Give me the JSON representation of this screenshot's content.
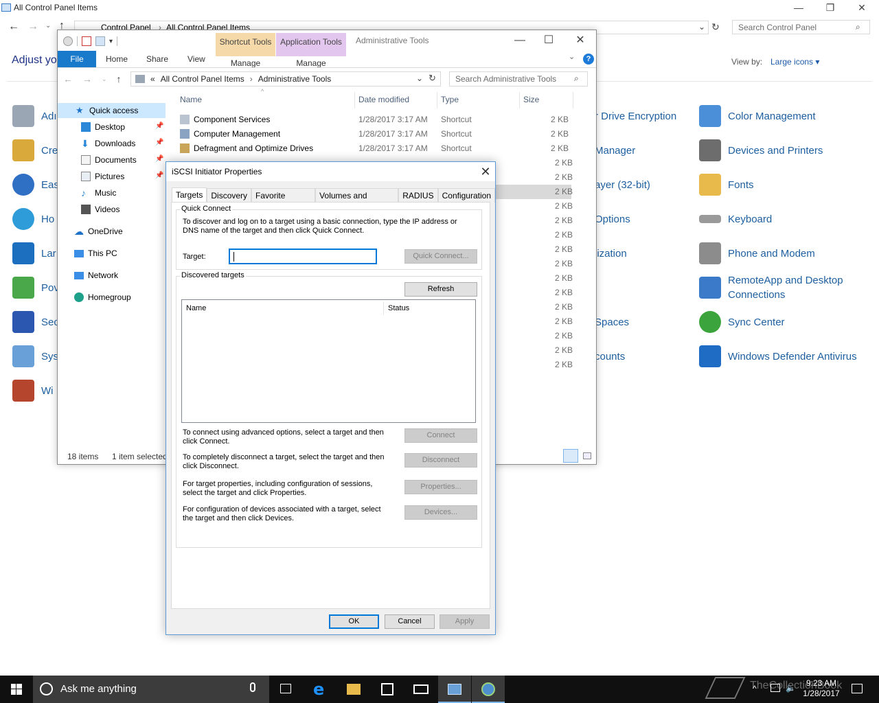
{
  "control_panel": {
    "title": "All Control Panel Items",
    "breadcrumb": [
      "Control Panel",
      "All Control Panel Items"
    ],
    "search_placeholder": "Search Control Panel",
    "heading": "Adjust yo",
    "view_by_label": "View by:",
    "view_by_value": "Large icons ▾",
    "left_column_partial": [
      "Adı",
      "Cre",
      "Eas",
      "Ho",
      "Lar",
      "Pov",
      "Sec",
      "Sys",
      "Wi"
    ],
    "middle_column_partial": [
      "r Drive Encryption",
      "Manager",
      "ayer (32-bit)",
      "Options",
      "lization",
      "Spaces",
      "counts"
    ],
    "right_column": [
      {
        "label": "Color Management",
        "icon": "color-management-icon",
        "color": "#4a8fd8"
      },
      {
        "label": "Devices and Printers",
        "icon": "printer-icon",
        "color": "#6d6d6d"
      },
      {
        "label": "Fonts",
        "icon": "fonts-icon",
        "color": "#e8b94b"
      },
      {
        "label": "Keyboard",
        "icon": "keyboard-icon",
        "color": "#9a9a9a"
      },
      {
        "label": "Phone and Modem",
        "icon": "phone-icon",
        "color": "#8c8c8c"
      },
      {
        "label": "RemoteApp and Desktop Connections",
        "icon": "remote-desktop-icon",
        "color": "#3b79c9"
      },
      {
        "label": "Sync Center",
        "icon": "sync-icon",
        "color": "#3ca43c"
      },
      {
        "label": "Windows Defender Antivirus",
        "icon": "shield-icon",
        "color": "#1f6cc5"
      }
    ]
  },
  "explorer": {
    "title": "Administrative Tools",
    "context_tabs": [
      {
        "group": "Shortcut Tools",
        "tab": "Manage"
      },
      {
        "group": "Application Tools",
        "tab": "Manage"
      }
    ],
    "tabs": [
      "File",
      "Home",
      "Share",
      "View"
    ],
    "address": [
      "«",
      "All Control Panel Items",
      "›",
      "Administrative Tools"
    ],
    "search_placeholder": "Search Administrative Tools",
    "columns": [
      "Name",
      "Date modified",
      "Type",
      "Size"
    ],
    "nav": [
      {
        "label": "Quick access",
        "pinned": false
      },
      {
        "label": "Desktop",
        "pinned": true
      },
      {
        "label": "Downloads",
        "pinned": true
      },
      {
        "label": "Documents",
        "pinned": true
      },
      {
        "label": "Pictures",
        "pinned": true
      },
      {
        "label": "Music",
        "pinned": false
      },
      {
        "label": "Videos",
        "pinned": false
      },
      {
        "label": "OneDrive",
        "pinned": false
      },
      {
        "label": "This PC",
        "pinned": false
      },
      {
        "label": "Network",
        "pinned": false
      },
      {
        "label": "Homegroup",
        "pinned": false
      }
    ],
    "files": [
      {
        "name": "Component Services",
        "date": "1/28/2017 3:17 AM",
        "type": "Shortcut",
        "size": "2 KB"
      },
      {
        "name": "Computer Management",
        "date": "1/28/2017 3:17 AM",
        "type": "Shortcut",
        "size": "2 KB"
      },
      {
        "name": "Defragment and Optimize Drives",
        "date": "1/28/2017 3:17 AM",
        "type": "Shortcut",
        "size": "2 KB"
      }
    ],
    "more_sizes": [
      "2 KB",
      "2 KB",
      "2 KB",
      "2 KB",
      "2 KB",
      "2 KB",
      "2 KB",
      "2 KB",
      "2 KB",
      "2 KB",
      "2 KB",
      "2 KB",
      "2 KB",
      "2 KB",
      "2 KB"
    ],
    "status_count": "18 items",
    "status_selected": "1 item selected"
  },
  "dialog": {
    "title": "iSCSI Initiator Properties",
    "tabs": [
      "Targets",
      "Discovery",
      "Favorite Targets",
      "Volumes and Devices",
      "RADIUS",
      "Configuration"
    ],
    "quick_connect": {
      "group_label": "Quick Connect",
      "description": "To discover and log on to a target using a basic connection, type the IP address or DNS name of the target and then click Quick Connect.",
      "target_label": "Target:",
      "target_value": "",
      "button": "Quick Connect..."
    },
    "discovered": {
      "group_label": "Discovered targets",
      "refresh": "Refresh",
      "columns": [
        "Name",
        "Status"
      ],
      "actions": [
        {
          "text": "To connect using advanced options, select a target and then click Connect.",
          "button": "Connect"
        },
        {
          "text": "To completely disconnect a target, select the target and then click Disconnect.",
          "button": "Disconnect"
        },
        {
          "text": "For target properties, including configuration of sessions, select the target and click Properties.",
          "button": "Properties..."
        },
        {
          "text": "For configuration of devices associated with a target, select the target and then click Devices.",
          "button": "Devices..."
        }
      ]
    },
    "buttons": {
      "ok": "OK",
      "cancel": "Cancel",
      "apply": "Apply"
    }
  },
  "taskbar": {
    "search_placeholder": "Ask me anything",
    "apps": [
      "task-view-icon",
      "edge-icon",
      "file-explorer-icon",
      "store-icon",
      "mail-icon",
      "control-panel-icon",
      "iscsi-icon"
    ],
    "watermark": "TheCollectionBook",
    "time": "9:23 AM",
    "date": "1/28/2017"
  }
}
